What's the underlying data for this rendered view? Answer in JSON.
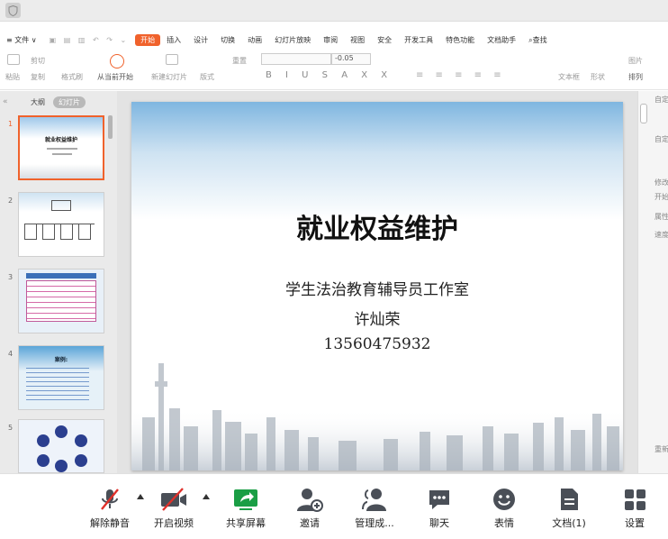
{
  "menu": {
    "file": "≡ 文件 ∨",
    "tabs": [
      "开始",
      "插入",
      "设计",
      "切换",
      "动画",
      "幻灯片放映",
      "审阅",
      "视图",
      "安全",
      "开发工具",
      "特色功能",
      "文档助手"
    ],
    "search": "查找",
    "active_tab": "开始"
  },
  "ribbon": {
    "paste": "粘贴",
    "cut": "剪切",
    "copy": "复制",
    "format_painter": "格式刷",
    "play_from_current": "从当前开始",
    "new_slide": "新建幻灯片",
    "layout": "版式",
    "reset": "重置",
    "font_size": "-0.05",
    "textbox": "文本框",
    "shape": "形状",
    "picture": "图片",
    "arrange": "排列"
  },
  "pane": {
    "tab_outline": "大纲",
    "tab_slides": "幻灯片",
    "slide_numbers": [
      "1",
      "2",
      "3",
      "4",
      "5"
    ],
    "thumb1_title": "就业权益维护",
    "thumb4_title": "案例:"
  },
  "slide": {
    "title": "就业权益维护",
    "subtitle": "学生法治教育辅导员工作室",
    "presenter": "许灿荣",
    "phone": "13560475932"
  },
  "right_pane": {
    "items": [
      "自定",
      "自定",
      "修改",
      "开始",
      "属性",
      "速度",
      "重新"
    ]
  },
  "bottom": {
    "unmute": "解除静音",
    "video": "开启视频",
    "share": "共享屏幕",
    "invite": "邀请",
    "manage": "管理成...",
    "chat": "聊天",
    "reactions": "表情",
    "docs": "文档(1)",
    "settings": "设置"
  },
  "colors": {
    "accent": "#f0622c",
    "share_green": "#1a9e45",
    "icon_gray": "#4a4f57",
    "mute_red": "#e0302a"
  }
}
